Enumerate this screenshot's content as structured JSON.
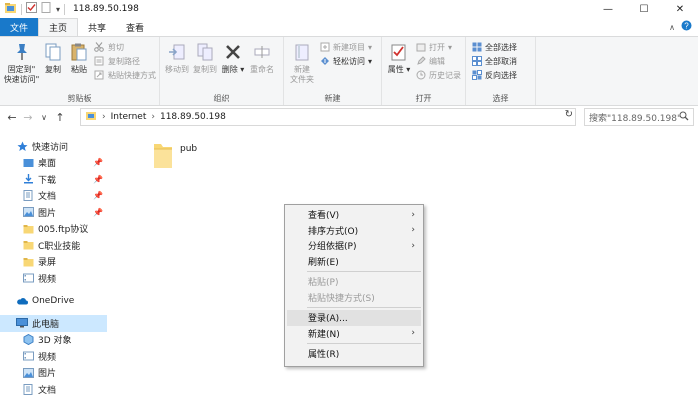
{
  "window": {
    "title": "118.89.50.198"
  },
  "tabs": {
    "file": "文件",
    "home": "主页",
    "share": "共享",
    "view": "查看"
  },
  "ribbon": {
    "clipboard": {
      "label": "剪贴板",
      "pin": "固定到\"\n快速访问\"",
      "copy": "复制",
      "paste": "粘贴",
      "cut": "剪切",
      "copy_path": "复制路径",
      "paste_shortcut": "粘贴快捷方式"
    },
    "organize": {
      "label": "组织",
      "move_to": "移动到",
      "copy_to": "复制到",
      "delete": "删除",
      "rename": "重命名"
    },
    "new": {
      "label": "新建",
      "new_folder": "新建\n文件夹",
      "new_item": "新建项目",
      "easy_access": "轻松访问"
    },
    "open": {
      "label": "打开",
      "properties": "属性",
      "open": "打开",
      "edit": "编辑",
      "history": "历史记录"
    },
    "select": {
      "label": "选择",
      "select_all": "全部选择",
      "select_none": "全部取消",
      "invert": "反向选择"
    }
  },
  "address": {
    "segments": [
      "Internet",
      "118.89.50.198"
    ],
    "search_placeholder": "搜索\"118.89.50.198\""
  },
  "navpane": {
    "quick_access": "快速访问",
    "items": [
      "桌面",
      "下载",
      "文档",
      "图片",
      "005.ftp协议",
      "C职业技能",
      "录屏",
      "视频"
    ],
    "onedrive": "OneDrive",
    "this_pc": "此电脑",
    "pc_items": [
      "3D 对象",
      "视频",
      "图片",
      "文档"
    ]
  },
  "content": {
    "files": [
      {
        "name": "pub"
      }
    ]
  },
  "context_menu": {
    "view": "查看(V)",
    "sort": "排序方式(O)",
    "group": "分组依据(P)",
    "refresh": "刷新(E)",
    "paste": "粘贴(P)",
    "paste_shortcut": "粘贴快捷方式(S)",
    "login": "登录(A)...",
    "new": "新建(N)",
    "properties": "属性(R)"
  },
  "colors": {
    "file_tab": "#1979ca",
    "ribbon_bg": "#f5f6f7",
    "selection": "#cce8ff",
    "folder": "#f8d775"
  }
}
